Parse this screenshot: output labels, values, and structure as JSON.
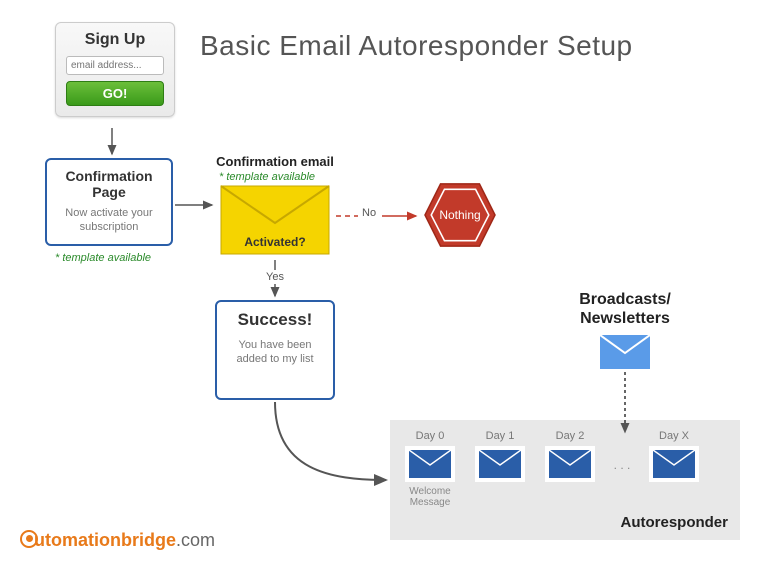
{
  "title": "Basic Email Autoresponder Setup",
  "signup": {
    "heading": "Sign Up",
    "placeholder": "email address...",
    "button": "GO!"
  },
  "confirmation_page": {
    "title": "Confirmation Page",
    "text": "Now activate your subscription",
    "template_note": "* template available"
  },
  "confirmation_email": {
    "label": "Confirmation email",
    "template_note": "* template available",
    "question": "Activated?"
  },
  "edges": {
    "no": "No",
    "yes": "Yes"
  },
  "nothing": "Nothing",
  "success": {
    "title": "Success!",
    "text": "You have been added to my list"
  },
  "broadcasts": {
    "line1": "Broadcasts/",
    "line2": "Newsletters"
  },
  "autoresponder": {
    "days": [
      "Day 0",
      "Day 1",
      "Day 2",
      "Day X"
    ],
    "welcome": "Welcome Message",
    "ellipsis": ". . .",
    "label": "Autoresponder"
  },
  "logo": {
    "part1": "utomation",
    "part2": "bridge",
    "domain": ".com"
  }
}
